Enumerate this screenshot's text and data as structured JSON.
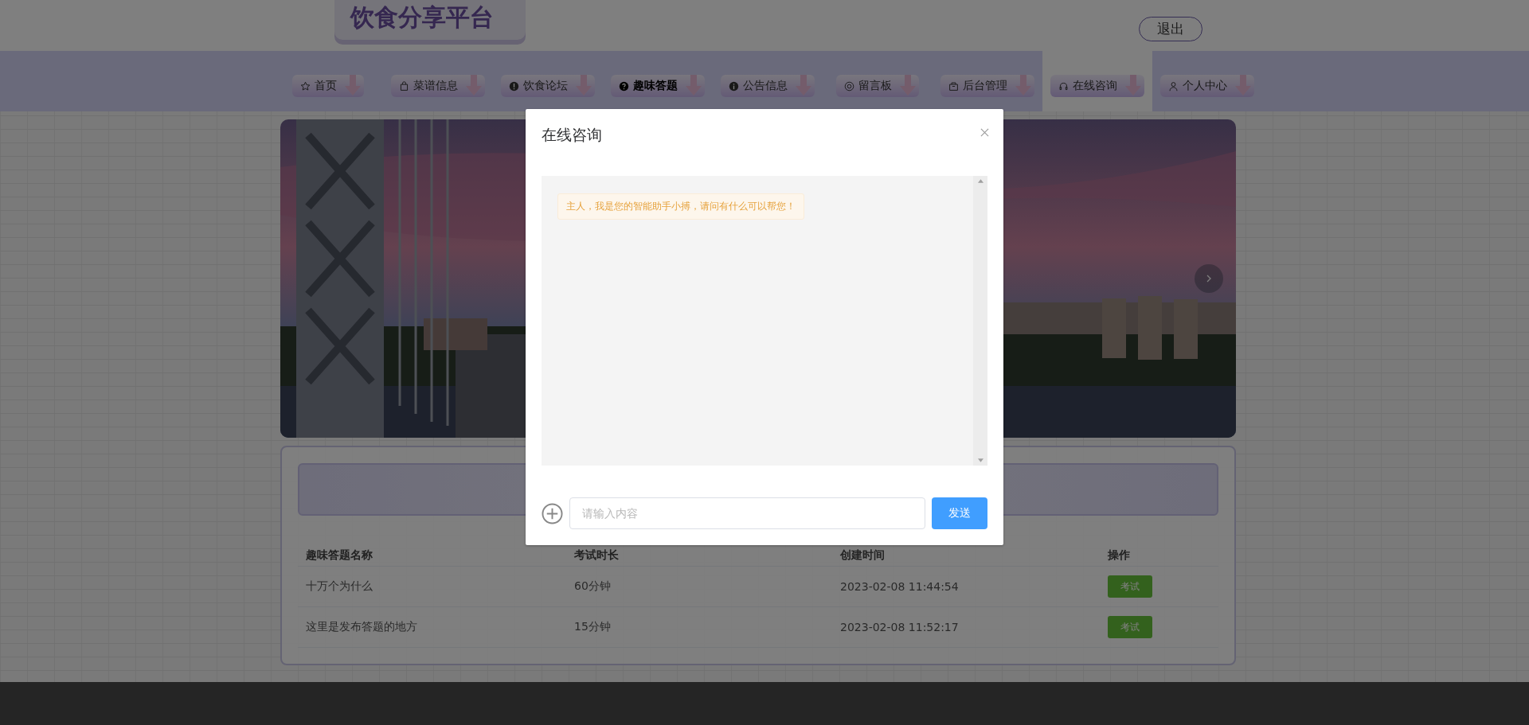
{
  "header": {
    "logo": "饮食分享平台",
    "logout": "退出"
  },
  "nav": [
    {
      "label": "首页",
      "selected": false,
      "current": false
    },
    {
      "label": "菜谱信息",
      "selected": false,
      "current": false
    },
    {
      "label": "饮食论坛",
      "selected": false,
      "current": false
    },
    {
      "label": "趣味答题",
      "selected": false,
      "current": true
    },
    {
      "label": "公告信息",
      "selected": false,
      "current": false
    },
    {
      "label": "留言板",
      "selected": false,
      "current": false
    },
    {
      "label": "后台管理",
      "selected": false,
      "current": false
    },
    {
      "label": "在线咨询",
      "selected": true,
      "current": false
    },
    {
      "label": "个人中心",
      "selected": false,
      "current": false
    }
  ],
  "table": {
    "columns": [
      "趣味答题名称",
      "考试时长",
      "创建时间",
      "操作"
    ],
    "rows": [
      {
        "name": "十万个为什么",
        "duration": "60分钟",
        "created": "2023-02-08 11:44:54",
        "action": "考试"
      },
      {
        "name": "这里是发布答题的地方",
        "duration": "15分钟",
        "created": "2023-02-08 11:52:17",
        "action": "考试"
      }
    ]
  },
  "dialog": {
    "title": "在线咨询",
    "messages": [
      "主人，我是您的智能助手小搏，请问有什么可以帮您！"
    ],
    "input": {
      "placeholder": "请输入内容"
    },
    "send": "发送"
  }
}
